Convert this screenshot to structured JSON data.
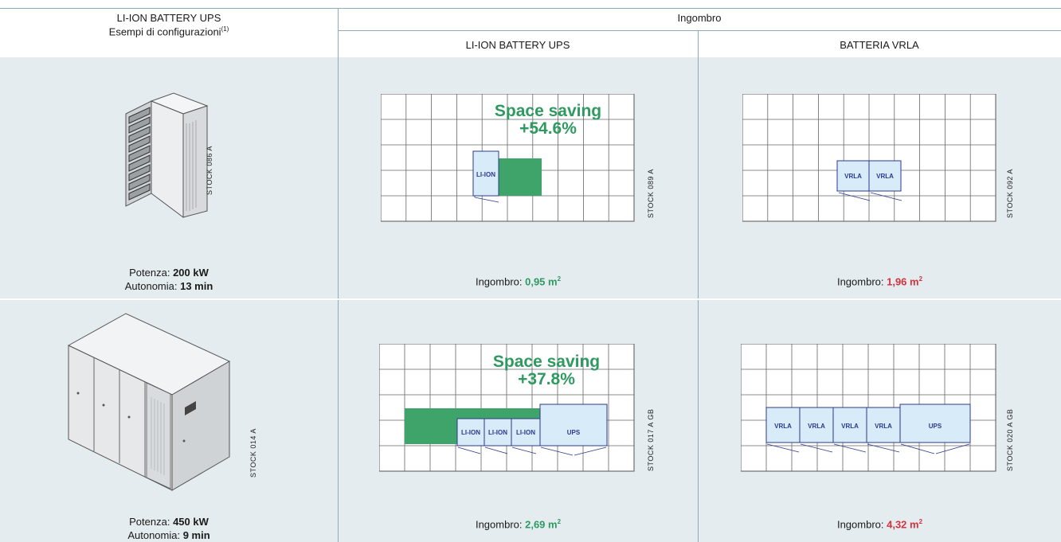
{
  "header": {
    "left_title": "LI-ION BATTERY UPS",
    "left_subtitle": "Esempi di configurazioni",
    "left_sup": "(1)",
    "group_title": "Ingombro",
    "col_liion": "LI-ION BATTERY UPS",
    "col_vrla": "BATTERIA VRLA"
  },
  "rows": [
    {
      "stock_ups": "STOCK 086 A",
      "power_label": "Potenza: ",
      "power_value": "200 kW",
      "autonomy_label": "Autonomia: ",
      "autonomy_value": "13 min",
      "liion": {
        "saving_title": "Space saving",
        "saving_value": "+54.6%",
        "stock": "STOCK 089 A",
        "footprint_label": "Ingombro: ",
        "footprint_value": "0,95 m",
        "footprint_unit_sup": "2",
        "blocks": [
          "LI-ION"
        ]
      },
      "vrla": {
        "stock": "STOCK 092 A",
        "footprint_label": "Ingombro: ",
        "footprint_value": "1,96 m",
        "footprint_unit_sup": "2",
        "blocks": [
          "VRLA",
          "VRLA"
        ]
      }
    },
    {
      "stock_ups": "STOCK 014 A",
      "power_label": "Potenza: ",
      "power_value": "450 kW",
      "autonomy_label": "Autonomia: ",
      "autonomy_value": "9 min",
      "liion": {
        "saving_title": "Space saving",
        "saving_value": "+37.8%",
        "stock": "STOCK 017 A GB",
        "footprint_label": "Ingombro: ",
        "footprint_value": "2,69 m",
        "footprint_unit_sup": "2",
        "blocks": [
          "LI-ION",
          "LI-ION",
          "LI-ION",
          "UPS"
        ]
      },
      "vrla": {
        "stock": "STOCK 020 A GB",
        "footprint_label": "Ingombro: ",
        "footprint_value": "4,32 m",
        "footprint_unit_sup": "2",
        "blocks": [
          "VRLA",
          "VRLA",
          "VRLA",
          "VRLA",
          "UPS"
        ]
      }
    }
  ],
  "colors": {
    "cell_bg": "#e4ecf0",
    "border": "#8fa9bd",
    "saving_green": "#2e9a5f",
    "vrla_red": "#d4333b",
    "block_fill": "#d7ebf8",
    "block_stroke": "#2b3a8c"
  }
}
